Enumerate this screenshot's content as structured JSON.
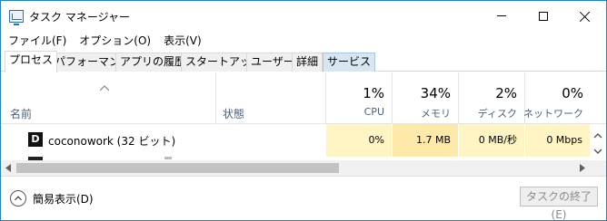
{
  "window": {
    "title": "タスク マネージャー"
  },
  "menu": [
    "ファイル(F)",
    "オプション(O)",
    "表示(V)"
  ],
  "tabs": [
    {
      "label": "プロセス",
      "active": true
    },
    {
      "label": "パフォーマンス"
    },
    {
      "label": "アプリの履歴"
    },
    {
      "label": "スタートアップ"
    },
    {
      "label": "ユーザー"
    },
    {
      "label": "詳細"
    },
    {
      "label": "サービス",
      "hover": true
    }
  ],
  "columns": {
    "name": "名前",
    "status": "状態",
    "cpu": {
      "percent": "1%",
      "label": "CPU"
    },
    "memory": {
      "percent": "34%",
      "label": "メモリ"
    },
    "disk": {
      "percent": "2%",
      "label": "ディスク"
    },
    "network": {
      "percent": "0%",
      "label": "ネットワーク"
    }
  },
  "rows": [
    {
      "icon": "coconowork-icon",
      "name": "coconowork (32 ビット)",
      "status": "",
      "cpu": "0%",
      "memory": "1.7 MB",
      "disk": "0 MB/秒",
      "network": "0 Mbps"
    }
  ],
  "footer": {
    "fewer_details": "簡易表示(D)",
    "end_task": "タスクの終了(E)"
  },
  "colors": {
    "window_border": "#1883d7",
    "cell_highlight": "#fff4c4",
    "memory_highlight": "#ffe9a8",
    "header_label": "#4c607a"
  }
}
